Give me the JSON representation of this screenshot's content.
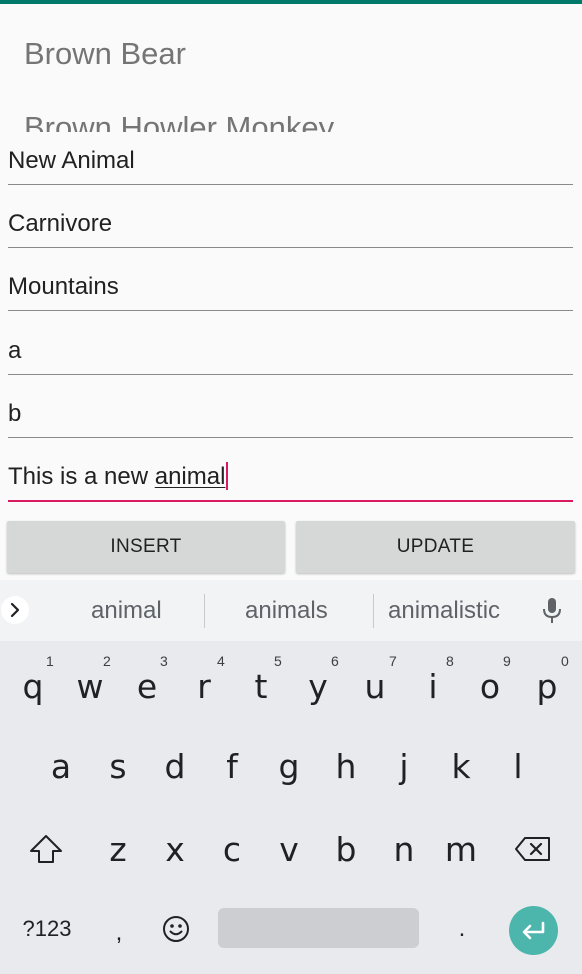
{
  "colors": {
    "accent": "#00796b",
    "focus_underline": "#d81b60",
    "button_bg": "#d6d7d7",
    "keyboard_bg": "#e8eaed",
    "enter_key": "#4db6ac"
  },
  "animal_list": {
    "items": [
      "Brown Bear",
      "Brown Howler Monkey"
    ]
  },
  "form": {
    "name": "New Animal",
    "diet": "Carnivore",
    "habitat": "Mountains",
    "field4": "a",
    "field5": "b",
    "description_prefix": "This is a new ",
    "description_composing": "animal"
  },
  "buttons": {
    "insert": "INSERT",
    "update": "UPDATE"
  },
  "keyboard": {
    "suggestions": [
      "animal",
      "animals",
      "animalistic"
    ],
    "row1": [
      "q",
      "w",
      "e",
      "r",
      "t",
      "y",
      "u",
      "i",
      "o",
      "p"
    ],
    "row1_hints": [
      "1",
      "2",
      "3",
      "4",
      "5",
      "6",
      "7",
      "8",
      "9",
      "0"
    ],
    "row2": [
      "a",
      "s",
      "d",
      "f",
      "g",
      "h",
      "j",
      "k",
      "l"
    ],
    "row3": [
      "z",
      "x",
      "c",
      "v",
      "b",
      "n",
      "m"
    ],
    "symbols_key": "?123",
    "comma_key": ",",
    "period_key": ".",
    "icons": [
      "chevron-right-icon",
      "mic-icon",
      "shift-icon",
      "backspace-icon",
      "emoji-icon",
      "enter-icon"
    ]
  }
}
